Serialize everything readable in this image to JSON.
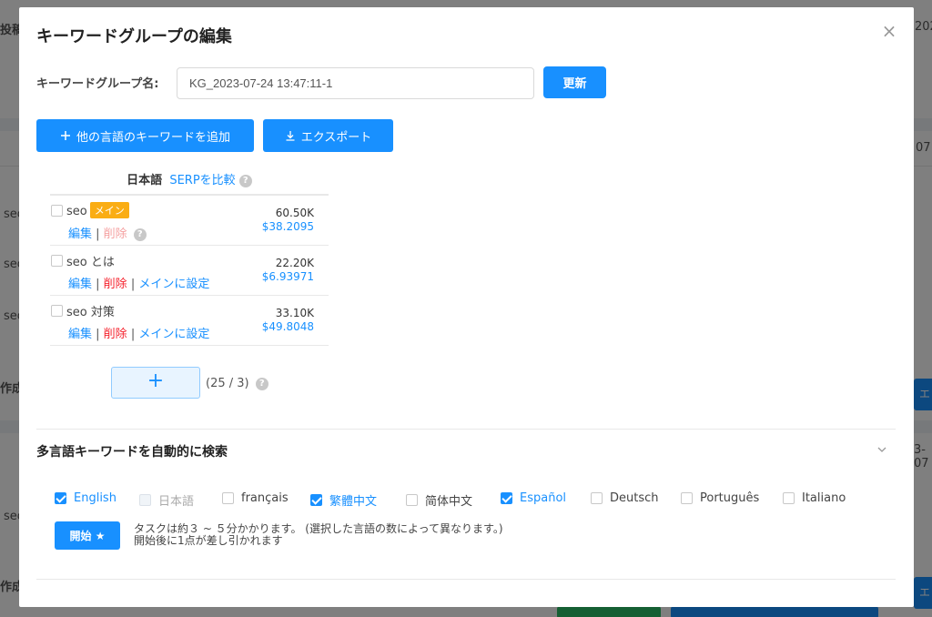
{
  "modal": {
    "title": "キーワードグループの編集",
    "close_symbol": "×"
  },
  "group_name": {
    "label": "キーワードグループ名:",
    "value": "KG_2023-07-24 13:47:11-1",
    "update_label": "更新"
  },
  "actions": {
    "add_language_label": "他の言語のキーワードを追加",
    "export_label": "エクスポート"
  },
  "keyword_table": {
    "language": "日本語",
    "compare_serp": "SERPを比較",
    "edit_label": "編集",
    "delete_label": "削除",
    "set_main_label": "メインに設定",
    "main_badge": "メイン",
    "rows": [
      {
        "keyword": "seo",
        "is_main": true,
        "volume": "60.50K",
        "cpc": "$38.2095"
      },
      {
        "keyword": "seo とは",
        "is_main": false,
        "volume": "22.20K",
        "cpc": "$6.93971"
      },
      {
        "keyword": "seo 対策",
        "is_main": false,
        "volume": "33.10K",
        "cpc": "$49.8048"
      }
    ],
    "count": "(25 / 3)"
  },
  "auto_search": {
    "title": "多言語キーワードを自動的に検索",
    "languages": [
      {
        "label": "English",
        "checked": true,
        "disabled": false
      },
      {
        "label": "日本語",
        "checked": false,
        "disabled": true
      },
      {
        "label": "français",
        "checked": false,
        "disabled": false
      },
      {
        "label": "繁體中文",
        "checked": true,
        "disabled": false
      },
      {
        "label": "简体中文",
        "checked": false,
        "disabled": false
      },
      {
        "label": "Español",
        "checked": true,
        "disabled": false
      },
      {
        "label": "Deutsch",
        "checked": false,
        "disabled": false
      },
      {
        "label": "Português",
        "checked": false,
        "disabled": false
      },
      {
        "label": "Italiano",
        "checked": false,
        "disabled": false
      }
    ],
    "start_label": "開始 ★",
    "note_line1": "タスクは約３ ~ ５分かかります。 (選択した言語の数によって異なります。)",
    "note_line2": "開始後に1点が差し引かれます"
  },
  "background": {
    "frag1": "投稿",
    "frag2": "202",
    "frag3": "07",
    "frag4": "seo",
    "frag5": "作成",
    "frag6": "3-07",
    "btn": "エ"
  },
  "colors": {
    "primary": "#1890ff",
    "danger": "#f5222d",
    "badge": "#faad14",
    "overlay": "rgba(0,0,0,0.5)"
  }
}
